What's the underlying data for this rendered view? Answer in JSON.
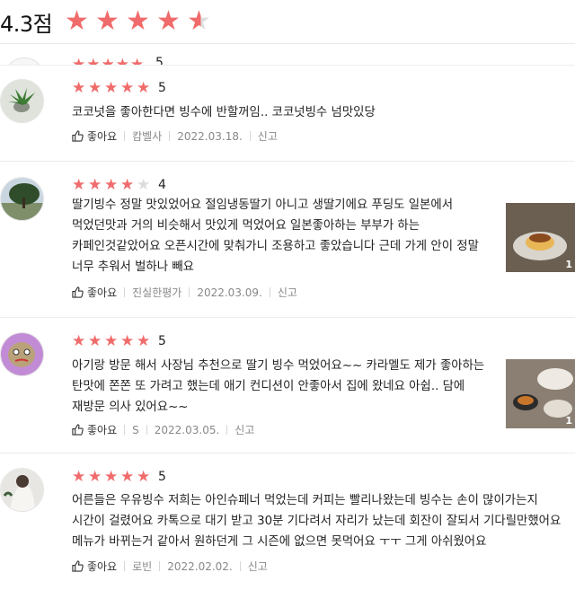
{
  "summary": {
    "rating_text": "4.3점",
    "rating": 4.3
  },
  "ghost_review": {
    "rating": 5,
    "score": "5"
  },
  "reviews": [
    {
      "rating": 5,
      "score": "5",
      "text": "코코넛을 좋아한다면 빙수에 반할꺼임.. 코코넛빙수 넘맛있당",
      "like_label": "좋아요",
      "author": "캄벨사",
      "date": "2022.03.18.",
      "report_label": "신고",
      "avatar_icon": "plant-avatar"
    },
    {
      "rating": 4,
      "score": "4",
      "text": "딸기빙수 정말 맛있었어요  절임냉동딸기 아니고 생딸기에요 푸딩도 일본에서 먹었던맛과 거의 비슷해서  맛있게 먹었어요  일본좋아하는 부부가 하는 카페인것같았어요 오픈시간에 맞춰가니 조용하고 좋았습니다  근데 가게 안이 정말 너무 추워서 벌하나 빼요",
      "like_label": "좋아요",
      "author": "진실한평가",
      "date": "2022.03.09.",
      "report_label": "신고",
      "avatar_icon": "tree-avatar",
      "photo_count": "1"
    },
    {
      "rating": 5,
      "score": "5",
      "text": "아기랑 방문 해서 사장님 추천으로 딸기 빙수 먹었어요~~ 카라멜도 제가 좋아하는 탄맛에 쫀쫀 또 가려고 했는데 애기 컨디션이 안좋아서 집에 왔네요 아쉽.. 담에 재방문 의사 있어요~~",
      "like_label": "좋아요",
      "author": "S",
      "date": "2022.03.05.",
      "report_label": "신고",
      "avatar_icon": "cartoon-face-avatar",
      "photo_count": "1"
    },
    {
      "rating": 5,
      "score": "5",
      "text": "어른들은 우유빙수 저희는 아인슈페너 먹었는데 커피는 빨리나왔는데 빙수는 손이 많이가는지 시간이 걸렸어요 카톡으로 대기 받고 30분 기다려서 자리가 났는데 회잔이 잘되서 기다릴만했어요 메뉴가 바뀌는거 같아서 원하던게 그 시즌에 없으면 못먹어요 ㅜㅜ 그게 아쉬웠어요",
      "like_label": "좋아요",
      "author": "로빈",
      "date": "2022.02.02.",
      "report_label": "신고",
      "avatar_icon": "wedding-photo-avatar"
    }
  ],
  "colors": {
    "star": "#f06b6b",
    "star_off": "#dcdcdc",
    "meta": "#888888"
  }
}
